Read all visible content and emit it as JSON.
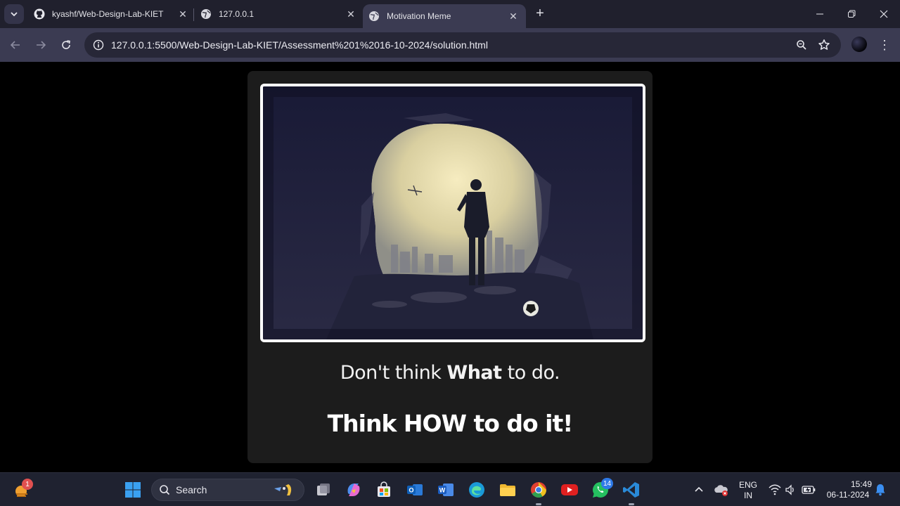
{
  "browser": {
    "tabs": [
      {
        "title": "kyashf/Web-Design-Lab-KIET",
        "favicon": "github-icon",
        "active": false
      },
      {
        "title": "127.0.0.1",
        "favicon": "globe-icon",
        "active": false
      },
      {
        "title": "Motivation Meme",
        "favicon": "globe-icon",
        "active": true
      }
    ],
    "new_tab_label": "+",
    "address_url": "127.0.0.1:5500/Web-Design-Lab-KIET/Assessment%201%2016-10-2024/solution.html"
  },
  "page": {
    "image_alt": "person standing in cave opening looking at city",
    "quote_line1": {
      "pre": "Don't think ",
      "bold": "What",
      "post": " to do."
    },
    "quote_line2": "Think HOW to do it!"
  },
  "taskbar": {
    "search_label": "Search",
    "weather_badge": "1",
    "whatsapp_badge": "14",
    "language_line1": "ENG",
    "language_line2": "IN",
    "time": "15:49",
    "date": "06-11-2024"
  },
  "colors": {
    "tabstrip_bg": "#20202d",
    "toolbar_bg": "#3b3b52",
    "card_bg": "#1c1c1c",
    "page_bg": "#000000",
    "taskbar_bg": "#1f2230"
  }
}
